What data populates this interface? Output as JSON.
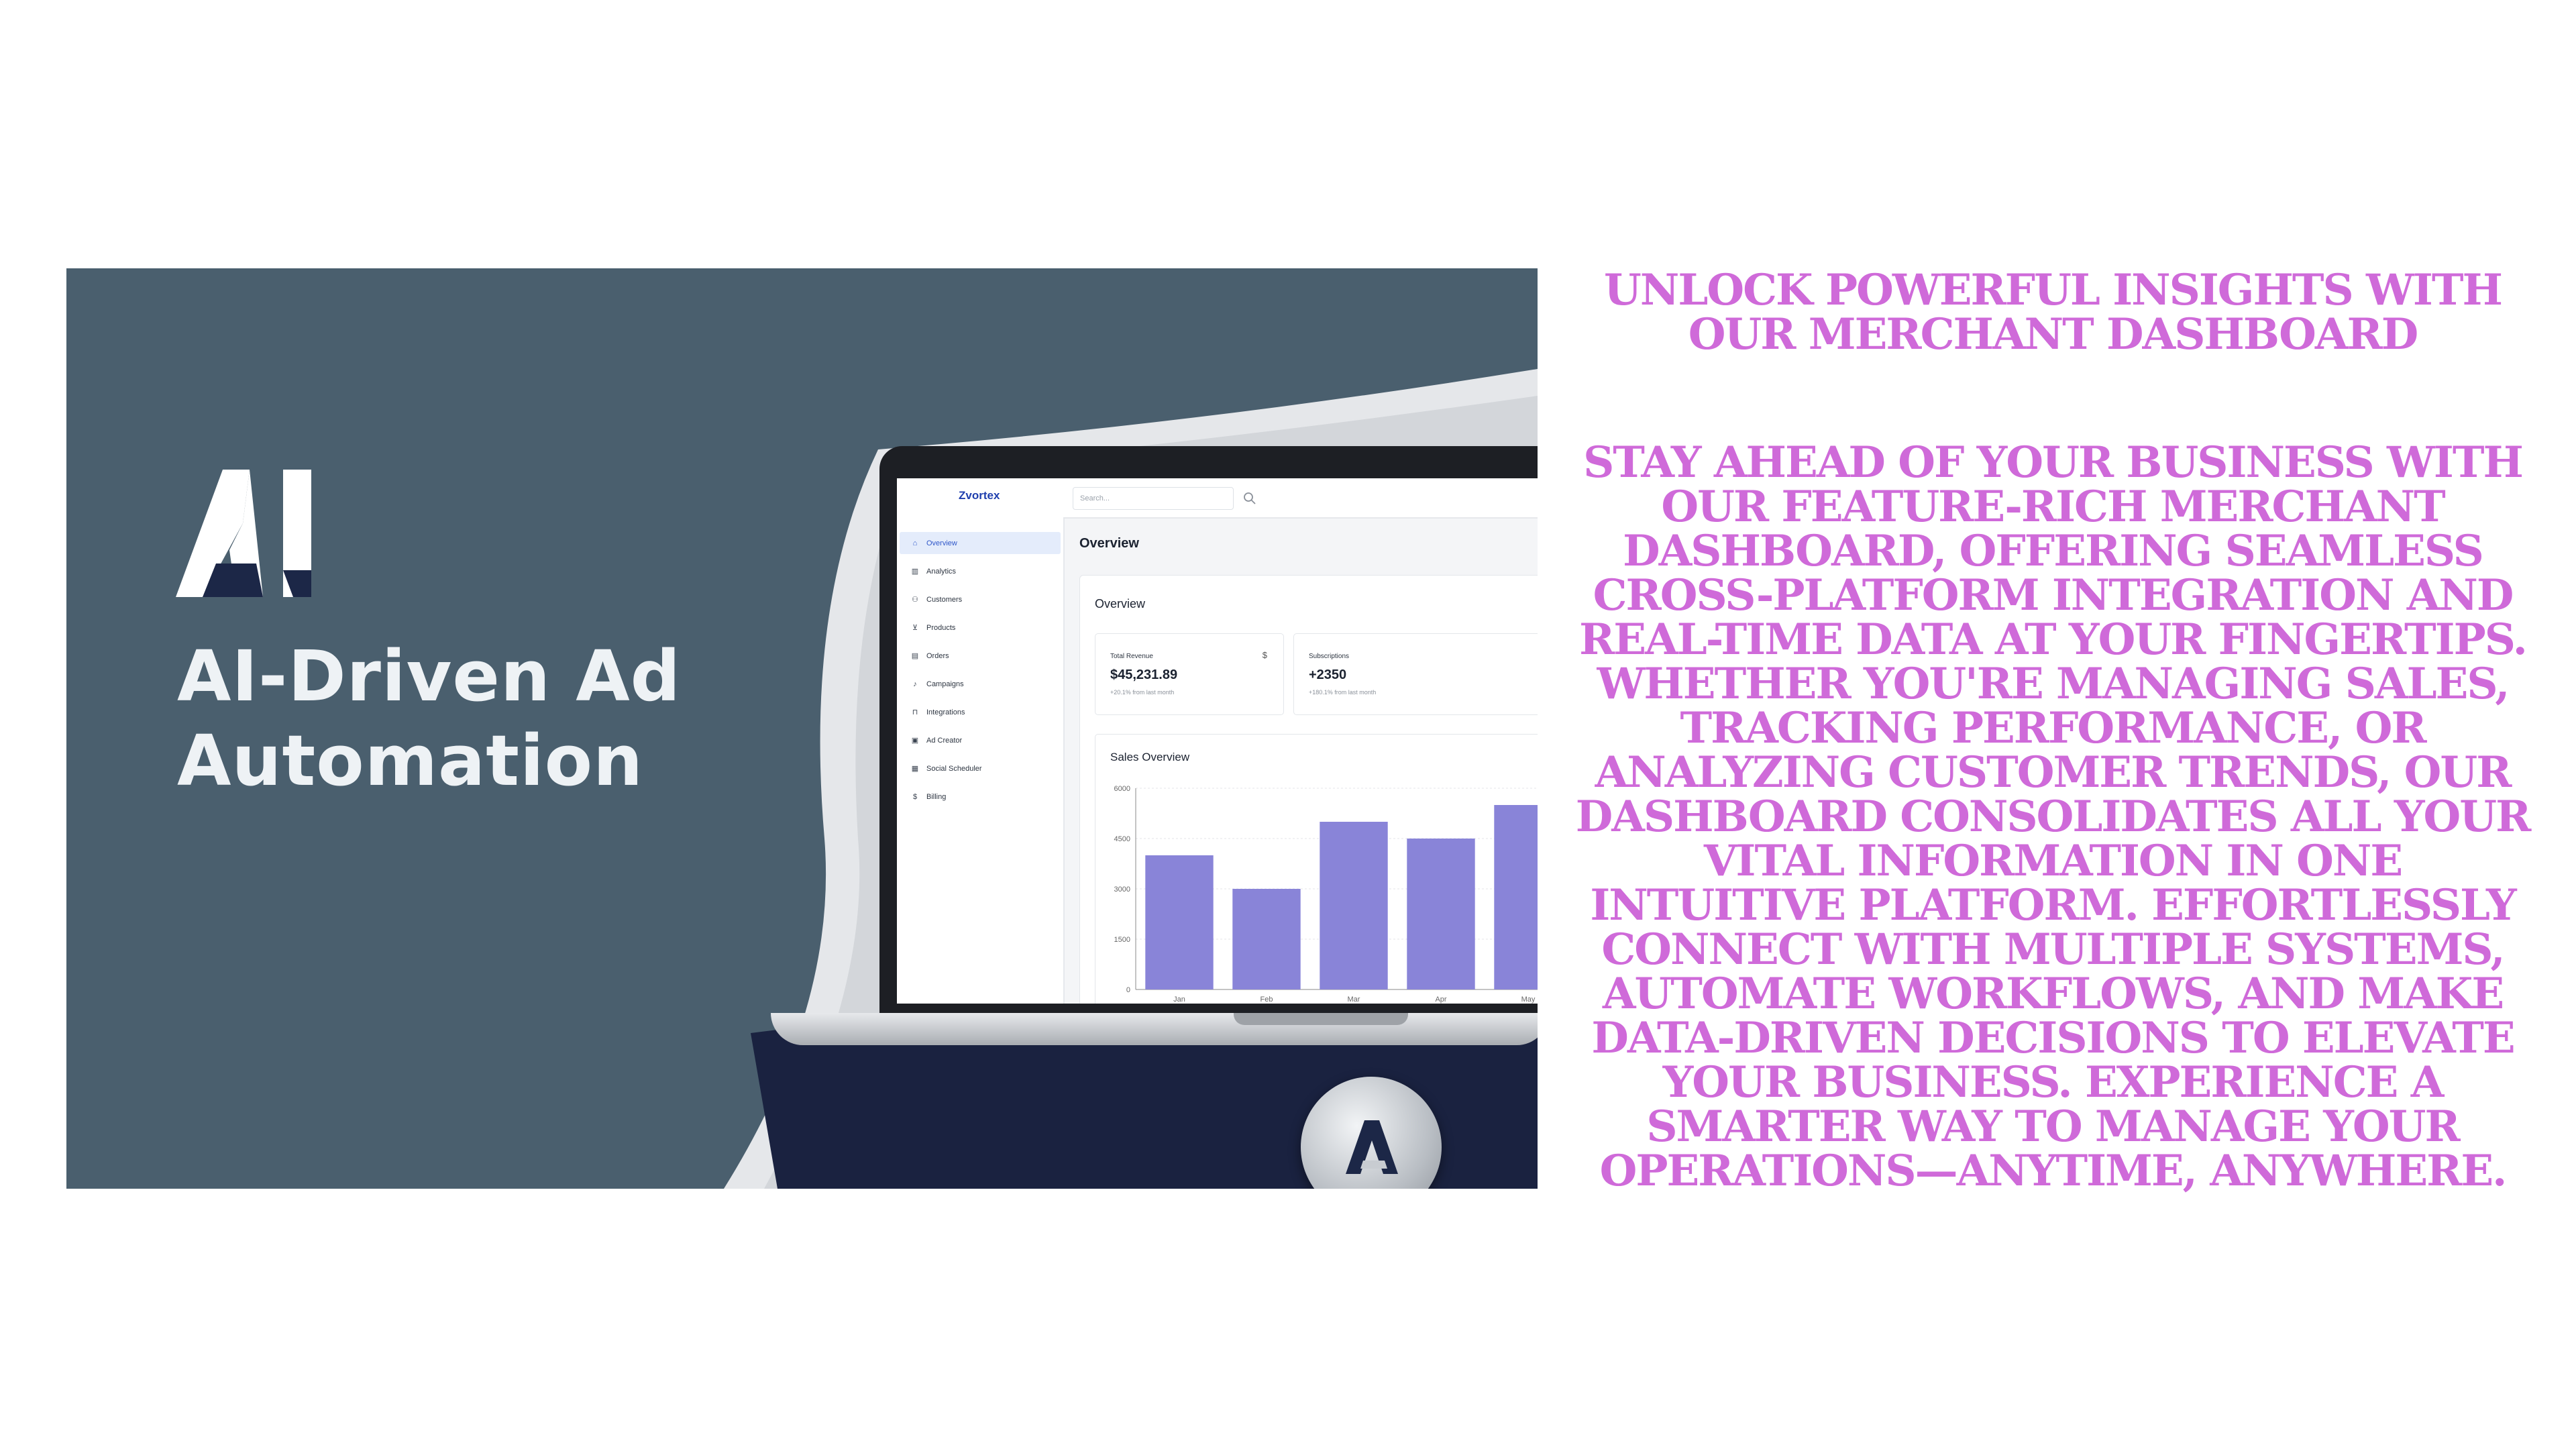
{
  "hero": {
    "logo_text": "AI",
    "headline_line1": "AI-Driven Ad",
    "headline_line2": "Automation"
  },
  "dashboard": {
    "brand": "Zvortex",
    "search": {
      "placeholder": "Search..."
    },
    "nav": [
      {
        "label": "Overview",
        "icon": "home-icon",
        "glyph": "⌂",
        "active": true
      },
      {
        "label": "Analytics",
        "icon": "bar-chart-icon",
        "glyph": "▥",
        "active": false
      },
      {
        "label": "Customers",
        "icon": "users-icon",
        "glyph": "⚇",
        "active": false
      },
      {
        "label": "Products",
        "icon": "cart-icon",
        "glyph": "⊻",
        "active": false
      },
      {
        "label": "Orders",
        "icon": "document-icon",
        "glyph": "▤",
        "active": false
      },
      {
        "label": "Campaigns",
        "icon": "bell-icon",
        "glyph": "♪",
        "active": false
      },
      {
        "label": "Integrations",
        "icon": "plug-icon",
        "glyph": "⊓",
        "active": false
      },
      {
        "label": "Ad Creator",
        "icon": "image-icon",
        "glyph": "▣",
        "active": false
      },
      {
        "label": "Social Scheduler",
        "icon": "calendar-icon",
        "glyph": "▦",
        "active": false
      },
      {
        "label": "Billing",
        "icon": "dollar-icon",
        "glyph": "$",
        "active": false
      }
    ],
    "page_title": "Overview",
    "panel_title": "Overview",
    "stats": [
      {
        "label": "Total Revenue",
        "symbol": "$",
        "value": "$45,231.89",
        "note": "+20.1% from last month"
      },
      {
        "label": "Subscriptions",
        "symbol": "",
        "value": "+2350",
        "note": "+180.1% from last month"
      }
    ],
    "sales_title": "Sales Overview"
  },
  "chart_data": {
    "type": "bar",
    "title": "Sales Overview",
    "categories": [
      "Jan",
      "Feb",
      "Mar",
      "Apr",
      "May"
    ],
    "values": [
      4000,
      3000,
      5000,
      4500,
      5500
    ],
    "ylim": [
      0,
      6000
    ],
    "yticks": [
      0,
      1500,
      3000,
      4500,
      6000
    ],
    "bar_color": "#8984d8",
    "grid": true
  },
  "copy": {
    "title": "UNLOCK POWERFUL INSIGHTS WITH OUR MERCHANT DASHBOARD",
    "body": "STAY AHEAD OF YOUR BUSINESS WITH OUR FEATURE-RICH MERCHANT DASHBOARD, OFFERING SEAMLESS CROSS-PLATFORM INTEGRATION AND REAL-TIME DATA AT YOUR FINGERTIPS. WHETHER YOU'RE MANAGING SALES, TRACKING PERFORMANCE, OR ANALYZING CUSTOMER TRENDS, OUR DASHBOARD CONSOLIDATES ALL YOUR VITAL INFORMATION IN ONE INTUITIVE PLATFORM. EFFORTLESSLY CONNECT WITH MULTIPLE SYSTEMS, AUTOMATE WORKFLOWS, AND MAKE DATA-DRIVEN DECISIONS TO ELEVATE YOUR BUSINESS. EXPERIENCE A SMARTER WAY TO MANAGE YOUR OPERATIONS—ANYTIME, ANYWHERE.",
    "color": "#cf6ad9"
  }
}
